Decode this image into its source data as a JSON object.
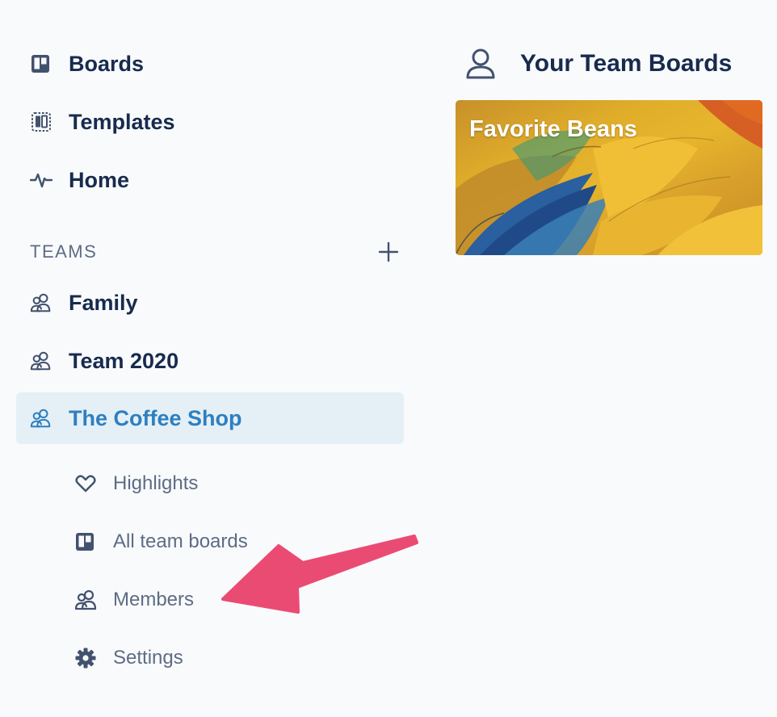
{
  "sidebar": {
    "nav": [
      {
        "label": "Boards",
        "icon": "board-icon"
      },
      {
        "label": "Templates",
        "icon": "template-icon"
      },
      {
        "label": "Home",
        "icon": "activity-icon"
      }
    ],
    "teams_title": "TEAMS",
    "add_icon": "plus-icon",
    "teams": [
      {
        "label": "Family",
        "icon": "team-icon"
      },
      {
        "label": "Team 2020",
        "icon": "team-icon"
      },
      {
        "label": "The Coffee Shop",
        "icon": "team-icon",
        "active": true
      }
    ],
    "team_sub": [
      {
        "label": "Highlights",
        "icon": "heart-icon"
      },
      {
        "label": "All team boards",
        "icon": "board-icon"
      },
      {
        "label": "Members",
        "icon": "team-icon"
      },
      {
        "label": "Settings",
        "icon": "gear-icon"
      }
    ]
  },
  "main": {
    "title": "Your Team Boards",
    "title_icon": "person-icon",
    "boards": [
      {
        "title": "Favorite Beans"
      }
    ]
  },
  "colors": {
    "text": "#172b4d",
    "muted": "#5e6c84",
    "active_bg": "#e4f0f6",
    "active_text": "#2e7fc0",
    "arrow": "#ea4b72"
  }
}
